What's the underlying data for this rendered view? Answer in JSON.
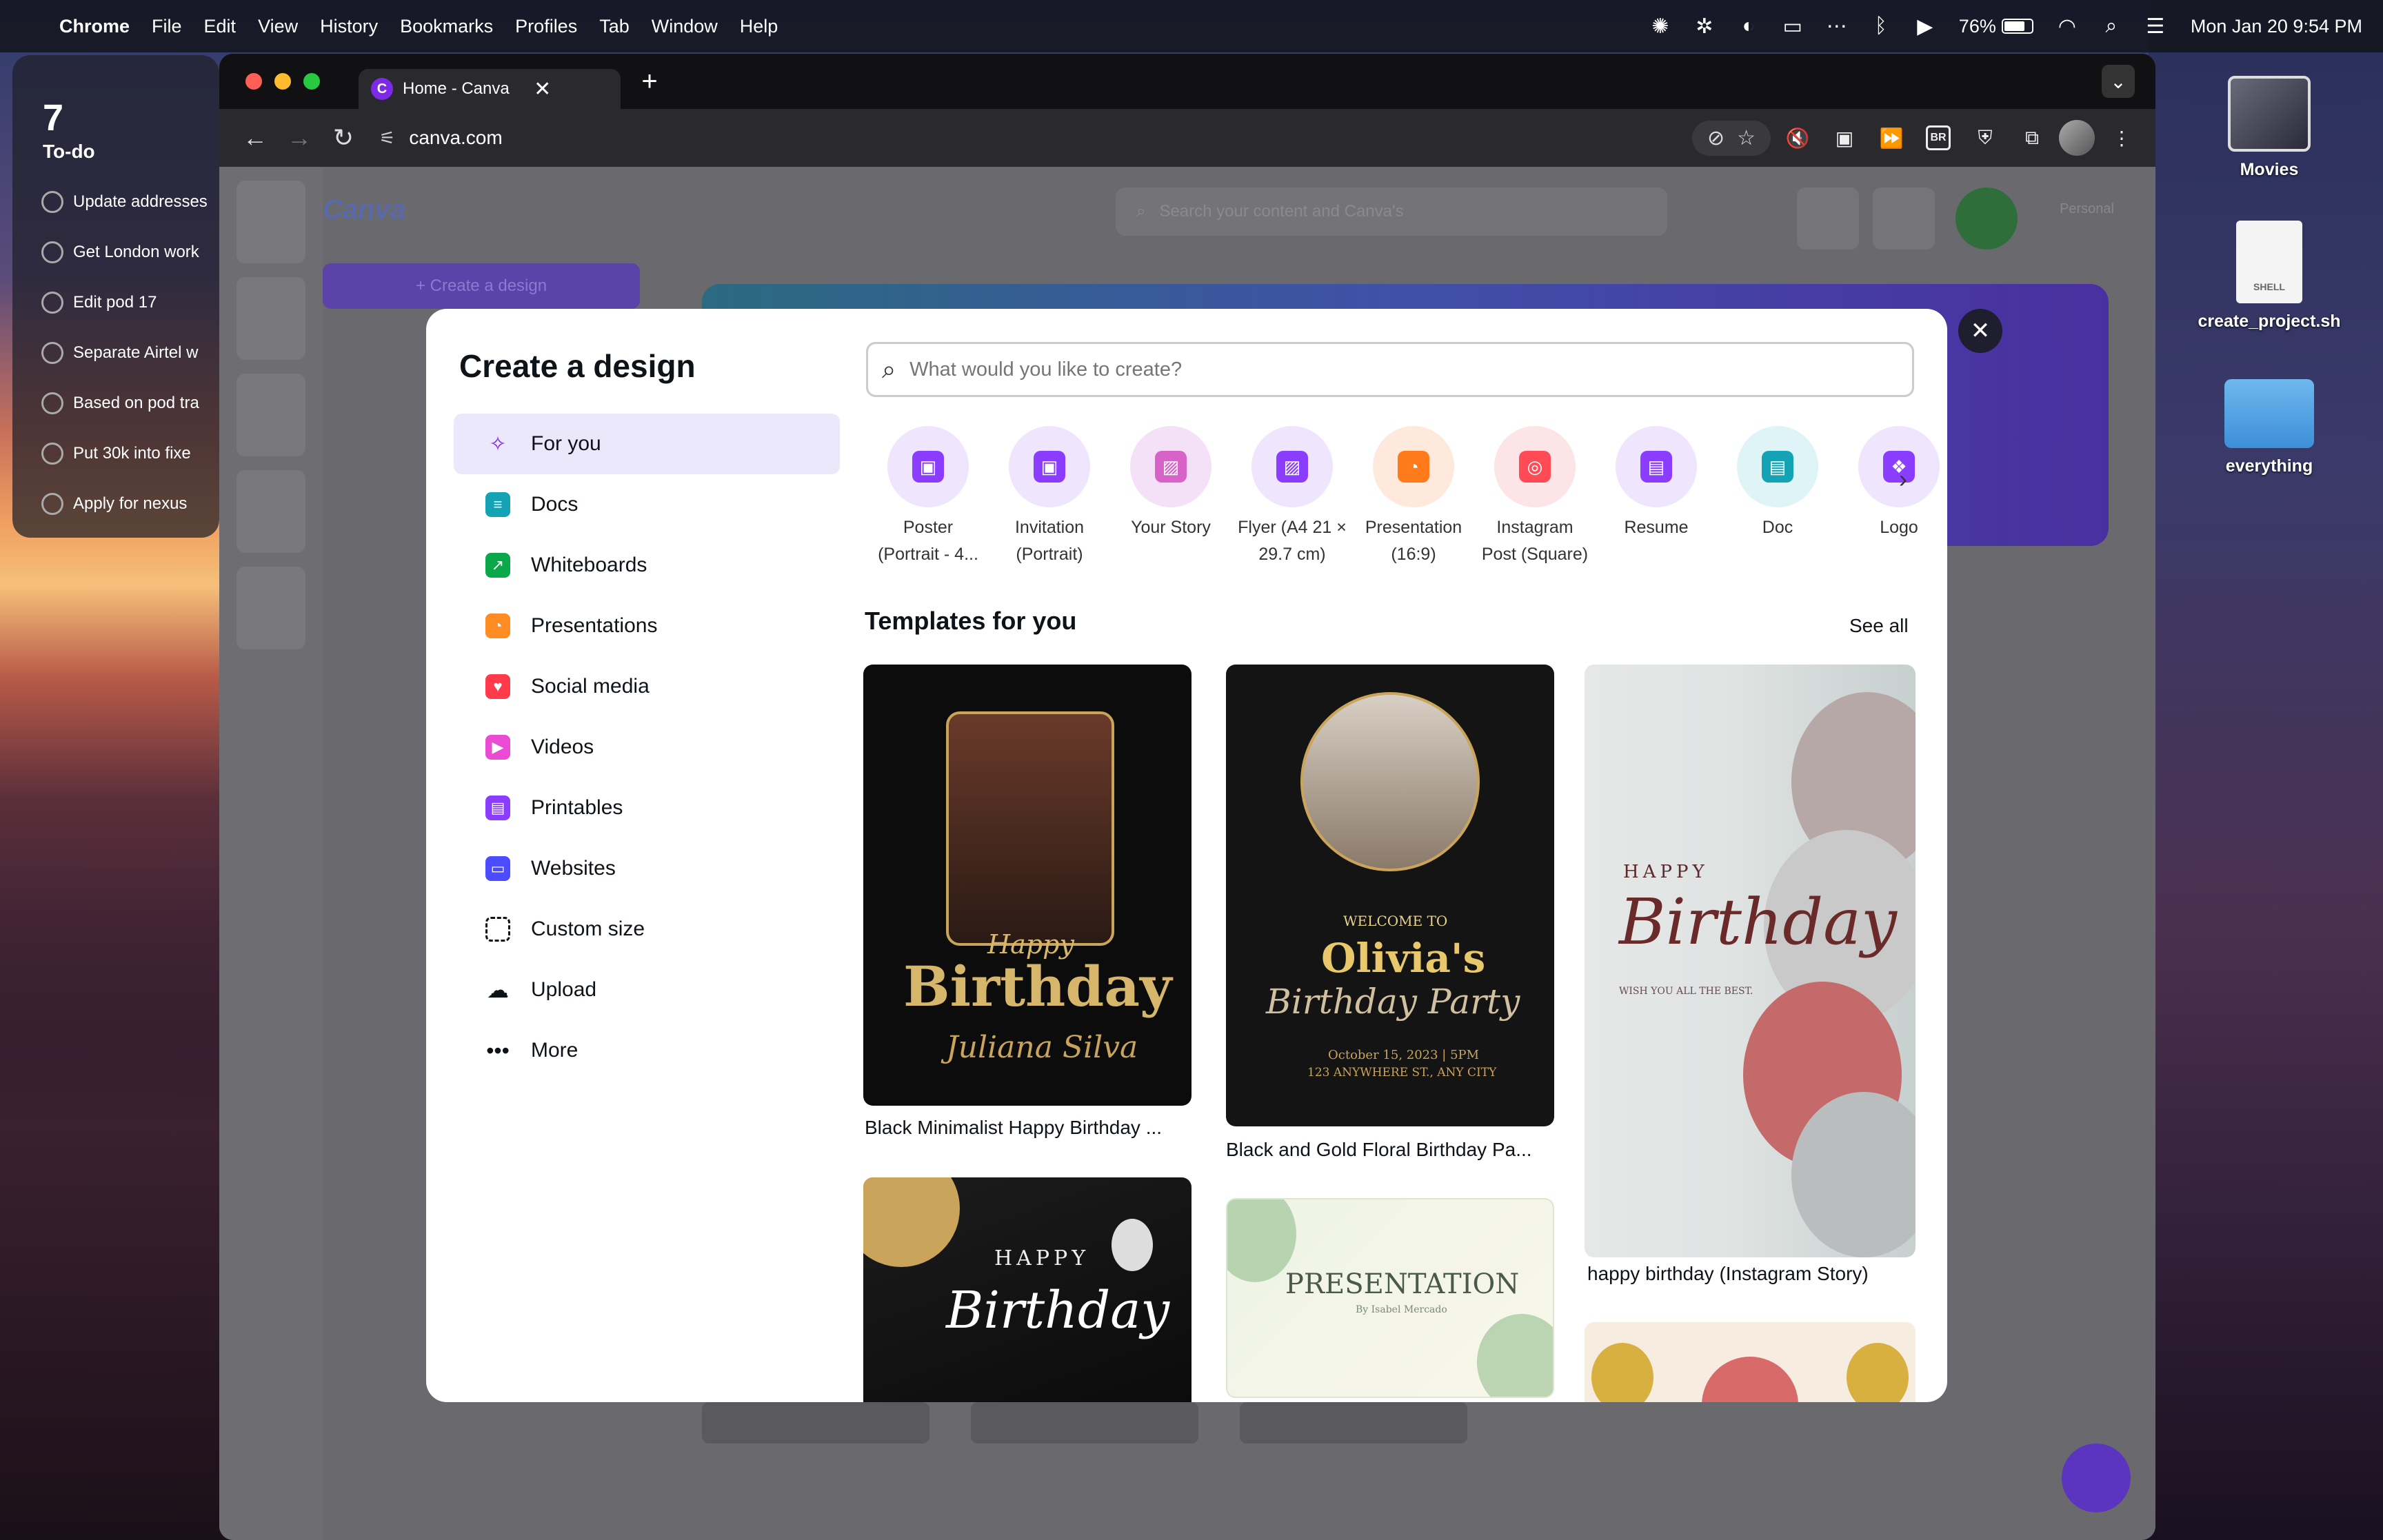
{
  "menubar": {
    "app": "Chrome",
    "items": [
      "File",
      "Edit",
      "View",
      "History",
      "Bookmarks",
      "Profiles",
      "Tab",
      "Window",
      "Help"
    ],
    "battery_percent": "76%",
    "battery_level": 0.76,
    "clock": "Mon Jan 20  9:54 PM"
  },
  "todo": {
    "count": "7",
    "title": "To-do",
    "items": [
      "Update addresses",
      "Get London work",
      "Edit pod 17",
      "Separate Airtel w",
      "Based on pod tra",
      "Put 30k into fixe",
      "Apply for nexus"
    ]
  },
  "desktop": {
    "movies": "Movies",
    "file": "create_project.sh",
    "file_badge": "SHELL",
    "folder": "everything"
  },
  "browser": {
    "tab_title": "Home - Canva",
    "url": "canva.com"
  },
  "canva": {
    "logo": "Canva",
    "create": "+ Create a design",
    "search": "Search your content and Canva's",
    "account": "Personal"
  },
  "modal": {
    "title": "Create a design",
    "search_placeholder": "What would you like to create?",
    "nav": [
      {
        "label": "For you",
        "icon": "sparkle-icon",
        "color": "#7d2ae8"
      },
      {
        "label": "Docs",
        "icon": "docs-icon",
        "color": "#13a3b5"
      },
      {
        "label": "Whiteboards",
        "icon": "whiteboard-icon",
        "color": "#0ba84a"
      },
      {
        "label": "Presentations",
        "icon": "presentation-icon",
        "color": "#ff8c22"
      },
      {
        "label": "Social media",
        "icon": "heart-icon",
        "color": "#ff3b4b"
      },
      {
        "label": "Videos",
        "icon": "video-icon",
        "color": "#e94bd2"
      },
      {
        "label": "Printables",
        "icon": "print-icon",
        "color": "#8b3dff"
      },
      {
        "label": "Websites",
        "icon": "website-icon",
        "color": "#4b4bff"
      },
      {
        "label": "Custom size",
        "icon": "resize-icon",
        "color": "#0e1318"
      },
      {
        "label": "Upload",
        "icon": "upload-icon",
        "color": "#0e1318"
      },
      {
        "label": "More",
        "icon": "more-icon",
        "color": "#0e1318"
      }
    ],
    "types": [
      {
        "l1": "Poster",
        "l2": "(Portrait - 4...",
        "bg": "#efe6fd",
        "fg": "#8b3dff"
      },
      {
        "l1": "Invitation",
        "l2": "(Portrait)",
        "bg": "#efe6fd",
        "fg": "#8b3dff"
      },
      {
        "l1": "Your Story",
        "l2": "",
        "bg": "#f4e1f7",
        "fg": "#d763c9"
      },
      {
        "l1": "Flyer (A4 21 ×",
        "l2": "29.7 cm)",
        "bg": "#efe6fd",
        "fg": "#8b3dff"
      },
      {
        "l1": "Presentation",
        "l2": "(16:9)",
        "bg": "#ffe9dc",
        "fg": "#ff7a1a"
      },
      {
        "l1": "Instagram",
        "l2": "Post (Square)",
        "bg": "#fde4e6",
        "fg": "#ff4b55"
      },
      {
        "l1": "Resume",
        "l2": "",
        "bg": "#efe6fd",
        "fg": "#8b3dff"
      },
      {
        "l1": "Doc",
        "l2": "",
        "bg": "#dff4f7",
        "fg": "#13a3b5"
      },
      {
        "l1": "Logo",
        "l2": "",
        "bg": "#efe6fd",
        "fg": "#8b3dff"
      }
    ],
    "templates_title": "Templates for you",
    "see_all": "See all",
    "templates": {
      "t1": {
        "caption": "Black Minimalist Happy Birthday ...",
        "script": "Happy",
        "big": "Birthday",
        "name": "Juliana Silva"
      },
      "t2": {
        "caption": "Black and Gold Floral Birthday Pa...",
        "welcome": "WELCOME TO",
        "name": "Olivia's",
        "sub": "Birthday Party",
        "date": "October 15, 2023 | 5PM",
        "addr": "123 ANYWHERE ST., ANY CITY"
      },
      "t3": {
        "caption": "happy birthday (Instagram Story)",
        "happy": "HAPPY",
        "big": "Birthday",
        "wish": "WISH YOU ALL THE BEST."
      },
      "t4": {
        "happy": "HAPPY",
        "big": "Birthday"
      },
      "t5": {
        "title": "PRESENTATION",
        "by": "By Isabel Mercado"
      }
    }
  }
}
